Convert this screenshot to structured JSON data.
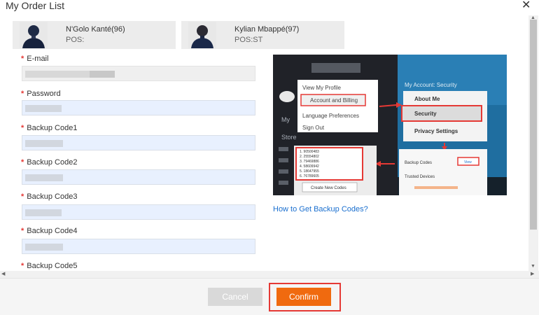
{
  "dialog": {
    "title": "My Order List",
    "close_glyph": "✕"
  },
  "players": [
    {
      "name": "N'Golo Kanté(96)",
      "pos": "POS:"
    },
    {
      "name": "Kylian Mbappé(97)",
      "pos": "POS:ST"
    }
  ],
  "form": {
    "required_mark": "*",
    "fields": [
      {
        "label": "E-mail",
        "value": ""
      },
      {
        "label": "Password",
        "value": ""
      },
      {
        "label": "Backup Code1",
        "value": ""
      },
      {
        "label": "Backup Code2",
        "value": ""
      },
      {
        "label": "Backup Code3",
        "value": ""
      },
      {
        "label": "Backup Code4",
        "value": ""
      },
      {
        "label": "Backup Code5",
        "value": ""
      }
    ]
  },
  "help_image": {
    "menu": [
      "View My Profile",
      "Account and Billing",
      "Language Preferences",
      "Sign Out"
    ],
    "account_title": "My Account: Security",
    "account_menu": [
      "About Me",
      "Security",
      "Privacy Settings"
    ],
    "codes": [
      "1. 90500483",
      "2. 25554802",
      "3. 79469886",
      "4. 58609942",
      "5. 18647955",
      "6. 76789605"
    ],
    "create_button": "Create New Codes",
    "backup_label": "Backup Codes",
    "view_label": "View",
    "trusted_label": "Trusted Devices",
    "side_labels": [
      "My",
      "Store"
    ]
  },
  "help_link": "How to Get Backup Codes?",
  "footer": {
    "cancel": "Cancel",
    "confirm": "Confirm"
  },
  "colors": {
    "accent": "#f06a0f",
    "highlight": "#e53935",
    "link": "#1a6fcf",
    "input_bg": "#e8f0fe"
  }
}
